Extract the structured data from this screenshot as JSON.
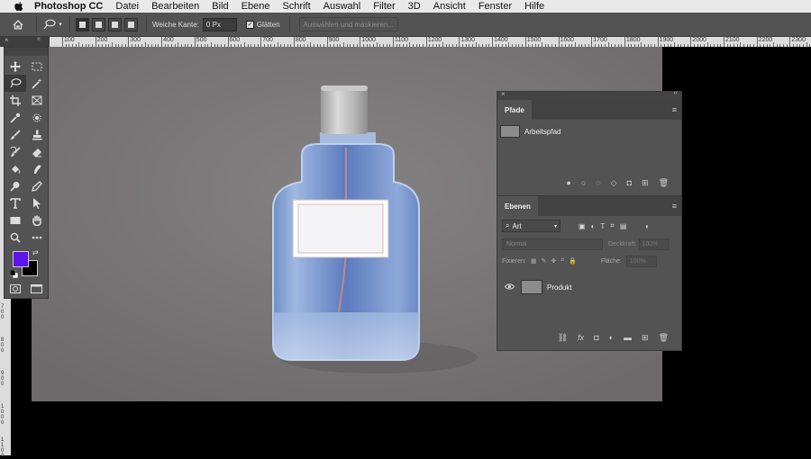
{
  "menubar": {
    "items": [
      "Photoshop CC",
      "Datei",
      "Bearbeiten",
      "Bild",
      "Ebene",
      "Schrift",
      "Auswahl",
      "Filter",
      "3D",
      "Ansicht",
      "Fenster",
      "Hilfe"
    ]
  },
  "options": {
    "feather_label": "Weiche Kante:",
    "feather_value": "0 Px",
    "smooth_label": "Glätten",
    "select_mask_label": "Auswählen und maskieren..."
  },
  "ruler": {
    "h_labels": [
      "100",
      "200",
      "300",
      "400",
      "500",
      "600",
      "700",
      "800",
      "900",
      "1000",
      "1100",
      "1200",
      "1300",
      "1400",
      "1500",
      "1600",
      "1700",
      "1800",
      "1900",
      "2000",
      "2100",
      "2200",
      "2300"
    ],
    "v_labels": [
      "700",
      "800",
      "900",
      "1000",
      "1100"
    ]
  },
  "colors": {
    "foreground": "#5b14ea",
    "background": "#000000",
    "panel": "#535353",
    "canvas": "#7a7677"
  },
  "paths_panel": {
    "tab": "Pfade",
    "items": [
      {
        "name": "Arbeitspfad"
      }
    ]
  },
  "layers_panel": {
    "tab": "Ebenen",
    "kind_filter": "Art",
    "blend_mode": "Normal",
    "opacity_label": "Deckkraft:",
    "opacity_value": "100%",
    "lock_label": "Fixieren:",
    "fill_label": "Fläche:",
    "fill_value": "100%",
    "layers": [
      {
        "name": "Produkt",
        "visible": true
      }
    ]
  }
}
